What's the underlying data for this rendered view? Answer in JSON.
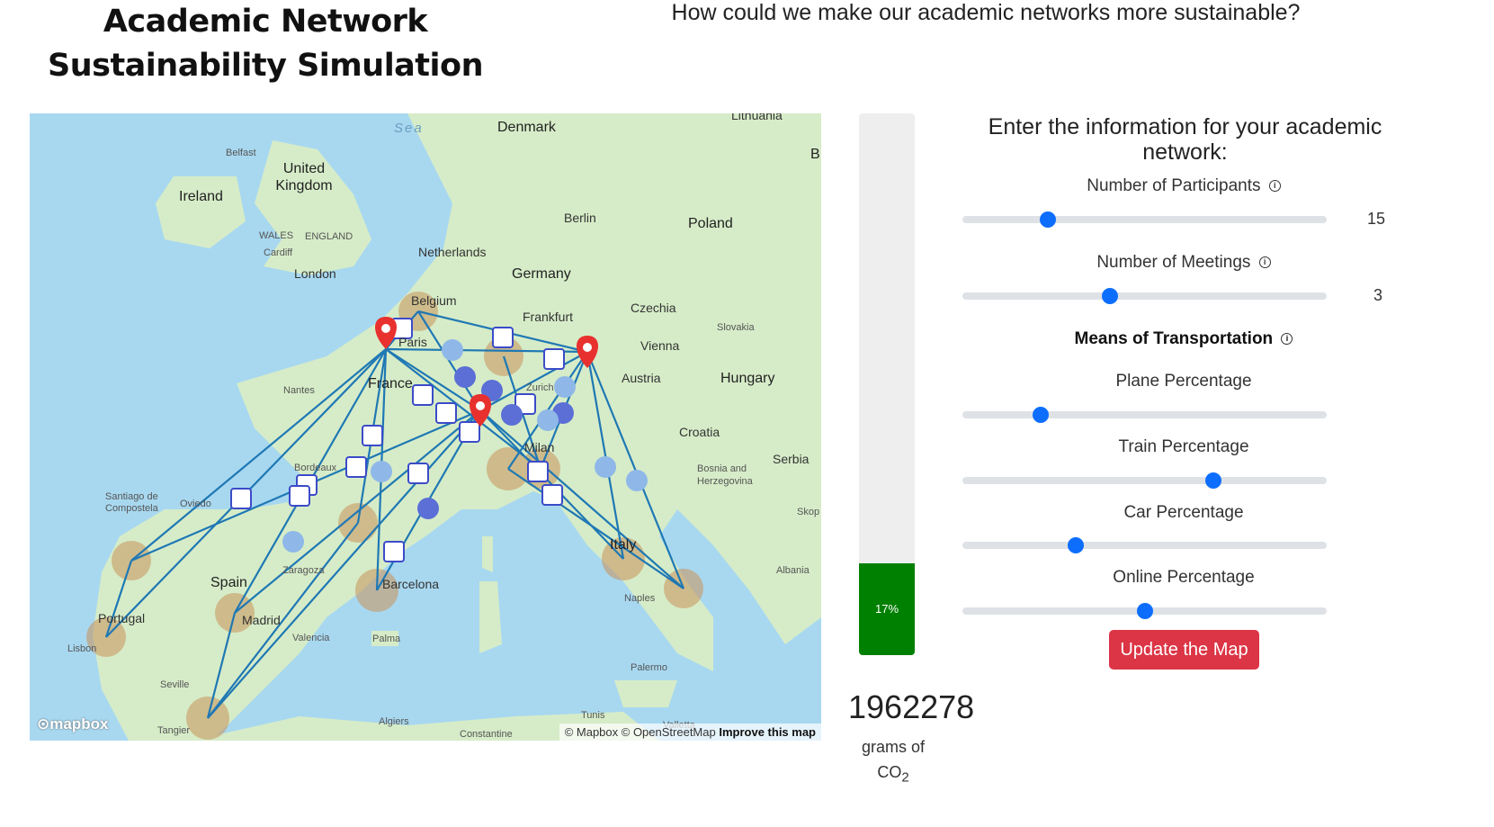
{
  "header": {
    "title": "Academic Network Sustainability Simulation",
    "question": "How could we make our academic networks more sustainable?"
  },
  "map": {
    "labels": {
      "sea": "Sea",
      "denmark": "Denmark",
      "lithuania": "Lithuania",
      "b": "B",
      "belfast": "Belfast",
      "uk": "United Kingdom",
      "ireland": "Ireland",
      "wales": "WALES",
      "england": "ENGLAND",
      "cardiff": "Cardiff",
      "london": "London",
      "netherlands": "Netherlands",
      "berlin": "Berlin",
      "poland": "Poland",
      "germany": "Germany",
      "belgium": "Belgium",
      "frankfurt": "Frankfurt",
      "czechia": "Czechia",
      "paris": "Paris",
      "slovakia": "Slovakia",
      "vienna": "Vienna",
      "austria": "Austria",
      "hungary": "Hungary",
      "nantes": "Nantes",
      "france": "France",
      "zurich": "Zurich",
      "croatia": "Croatia",
      "milan": "Milan",
      "bordeaux": "Bordeaux",
      "bosnia": "Bosnia and Herzegovina",
      "serbia": "Serbia",
      "santiago": "Santiago de Compostela",
      "oviedo": "Oviedo",
      "skop": "Skop",
      "italy": "Italy",
      "zaragoza": "Zaragoza",
      "spain": "Spain",
      "barcelona": "Barcelona",
      "albania": "Albania",
      "portugal": "Portugal",
      "madrid": "Madrid",
      "naples": "Naples",
      "valencia": "Valencia",
      "palma": "Palma",
      "lisbon": "Lisbon",
      "palermo": "Palermo",
      "seville": "Seville",
      "tunis": "Tunis",
      "algiers": "Algiers",
      "tangier": "Tangier",
      "constantine": "Constantine",
      "valletta": "Valletta"
    },
    "logo": "mapbox",
    "attribution": "© Mapbox © OpenStreetMap",
    "improve_link": "Improve this map",
    "colors": {
      "water": "#a8d8f0",
      "land": "#d6ecc8",
      "route": "#1f78b4",
      "pin": "#e8312f",
      "train_icon": "#3b4bc8",
      "plane_icon": "#5b6fd6",
      "car_icon": "#8fb8e8",
      "circle": "#c8935a"
    }
  },
  "impact": {
    "progress_percent": 17,
    "progress_label": "17%",
    "progress_color": "#008000",
    "co2_value": "1962278",
    "co2_unit_line1": "grams of",
    "co2_unit_line2": "CO",
    "co2_sub": "2"
  },
  "form": {
    "heading": "Enter the information for your academic network:",
    "participants": {
      "label": "Number of Participants",
      "value": "15",
      "fraction": 0.235
    },
    "meetings": {
      "label": "Number of Meetings",
      "value": "3",
      "fraction": 0.405
    },
    "transport_heading": "Means of Transportation",
    "plane": {
      "label": "Plane Percentage",
      "fraction": 0.215
    },
    "train": {
      "label": "Train Percentage",
      "fraction": 0.69
    },
    "car": {
      "label": "Car Percentage",
      "fraction": 0.31
    },
    "online": {
      "label": "Online Percentage",
      "fraction": 0.5
    },
    "update_button": "Update the Map"
  }
}
